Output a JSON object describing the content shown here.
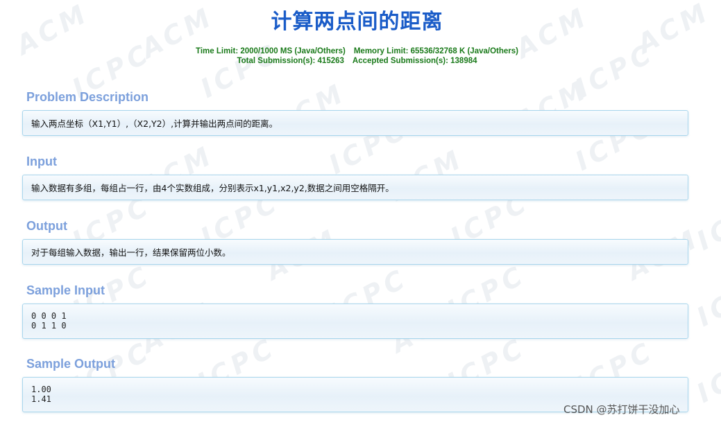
{
  "title": "计算两点间的距离",
  "limits": {
    "time_limit": "Time Limit: 2000/1000 MS (Java/Others)",
    "memory_limit": "Memory Limit: 65536/32768 K (Java/Others)",
    "total_submissions": "Total Submission(s): 415263",
    "accepted_submissions": "Accepted Submission(s): 138984"
  },
  "sections": {
    "description": {
      "heading": "Problem Description",
      "body": "输入两点坐标（X1,Y1）,（X2,Y2）,计算并输出两点间的距离。"
    },
    "input": {
      "heading": "Input",
      "body": "输入数据有多组，每组占一行，由4个实数组成，分别表示x1,y1,x2,y2,数据之间用空格隔开。"
    },
    "output": {
      "heading": "Output",
      "body": "对于每组输入数据，输出一行，结果保留两位小数。"
    },
    "sample_input": {
      "heading": "Sample Input",
      "body": "0 0 0 1\n0 1 1 0"
    },
    "sample_output": {
      "heading": "Sample Output",
      "body": "1.00\n1.41"
    }
  },
  "watermark": {
    "text_acm": "ACM",
    "text_icpc": "ICPC",
    "color": "#eef1f4"
  },
  "footer": {
    "credit": "CSDN @苏打饼干没加心"
  },
  "colors": {
    "title": "#1a5cc8",
    "limits": "#1a7a1a",
    "section_heading": "#7ca0dc",
    "panel_border": "#a9d6ec"
  }
}
